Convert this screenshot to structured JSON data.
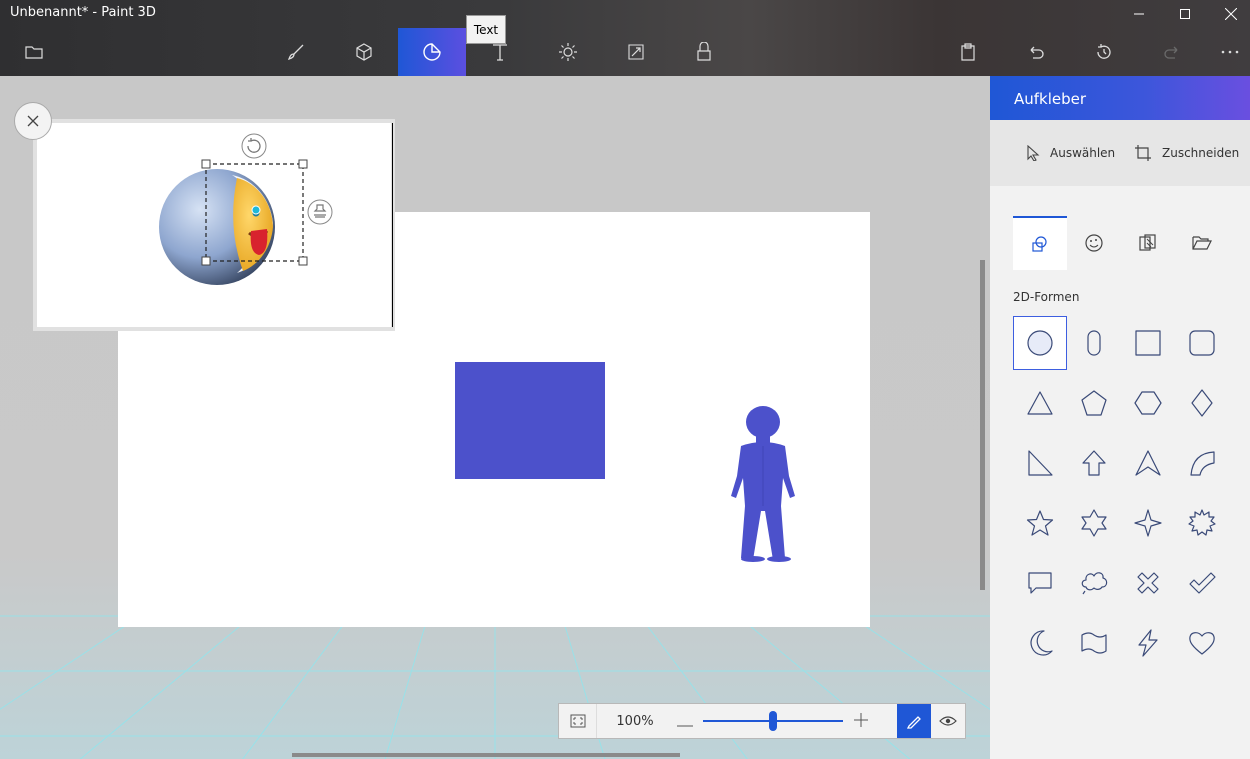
{
  "window": {
    "title": "Unbenannt* - Paint 3D"
  },
  "toolbar": {
    "tooltip": "Text",
    "tools": [
      {
        "name": "menu-folder",
        "icon": "folder-icon"
      },
      {
        "name": "brushes",
        "icon": "brush-icon"
      },
      {
        "name": "3d-shapes",
        "icon": "cube-icon"
      },
      {
        "name": "stickers",
        "icon": "sticker-icon",
        "active": true
      },
      {
        "name": "text",
        "icon": "text-icon"
      },
      {
        "name": "effects",
        "icon": "sun-icon"
      },
      {
        "name": "canvas",
        "icon": "resize-icon"
      },
      {
        "name": "3d-library",
        "icon": "library-icon"
      }
    ]
  },
  "zoom": {
    "percent_label": "100%",
    "level_fraction": 0.5
  },
  "sidebar": {
    "title": "Aufkleber",
    "select_label": "Auswählen",
    "crop_label": "Zuschneiden",
    "section_label": "2D-Formen",
    "tabs": [
      "shapes-icon",
      "stickers-palette-icon",
      "textures-icon",
      "open-folder-icon"
    ],
    "shapes": [
      "circle",
      "pill",
      "square",
      "rounded-square",
      "triangle",
      "pentagon",
      "hexagon",
      "diamond",
      "right-triangle",
      "arrow-up",
      "arrowhead",
      "quarter-circle",
      "star5",
      "star6",
      "star4",
      "burst",
      "speech-bubble",
      "thought-cloud",
      "x-mark",
      "check-mark",
      "crescent",
      "flag",
      "lightning",
      "heart"
    ]
  },
  "colors": {
    "accent": "#1f57d6",
    "shape_fill": "#4c51cb"
  }
}
